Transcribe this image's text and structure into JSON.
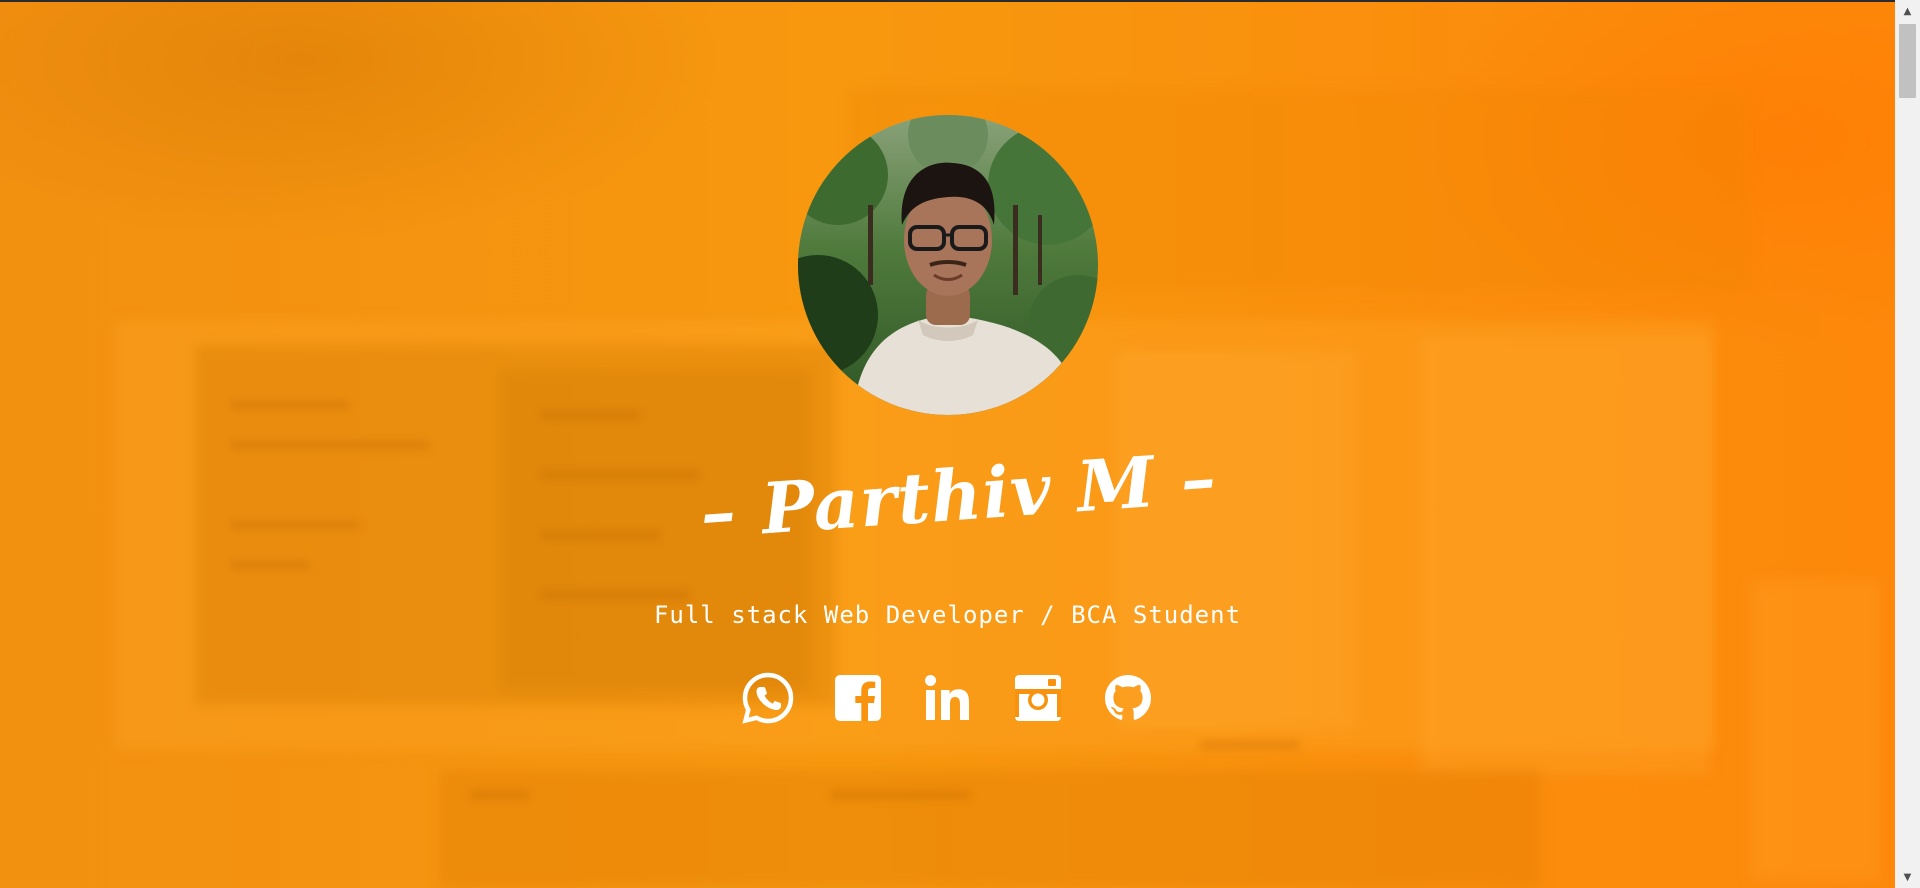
{
  "profile": {
    "name": "Parthiv M",
    "dash_left": "–",
    "dash_right": "–",
    "subtitle": "Full stack Web Developer / BCA Student",
    "avatar_alt": "avatar"
  },
  "socials": [
    {
      "name": "whatsapp",
      "icon": "whatsapp-icon"
    },
    {
      "name": "facebook",
      "icon": "facebook-icon"
    },
    {
      "name": "linkedin",
      "icon": "linkedin-icon"
    },
    {
      "name": "instagram",
      "icon": "instagram-icon"
    },
    {
      "name": "github",
      "icon": "github-icon"
    }
  ],
  "colors": {
    "background": "#f7930f",
    "text": "#ffffff",
    "scrollbar_track": "#f1f1f1",
    "scrollbar_thumb": "#c1c1c1"
  },
  "scrollbar": {
    "up_arrow": "▲",
    "down_arrow": "▼"
  }
}
